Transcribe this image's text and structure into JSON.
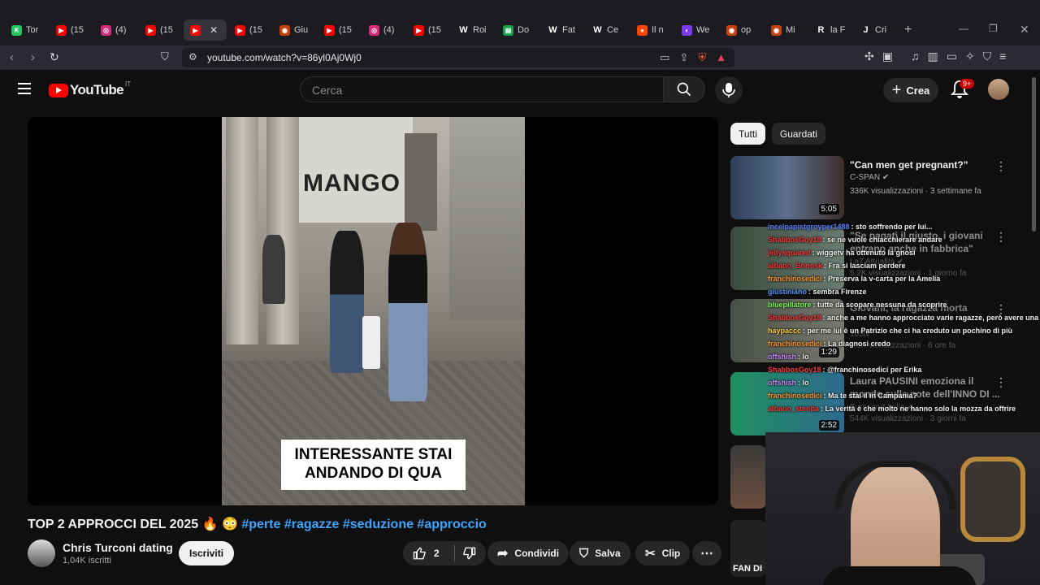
{
  "browser": {
    "tabs": [
      {
        "label": "Tor",
        "icon": "k-icon",
        "color": "#22c55e",
        "letter": "K"
      },
      {
        "label": "(15",
        "icon": "youtube-icon",
        "color": "#ff0000",
        "letter": "▶"
      },
      {
        "label": "(4)",
        "icon": "instagram-icon",
        "color": "#d62976",
        "letter": "◎"
      },
      {
        "label": "(15",
        "icon": "youtube-icon",
        "color": "#ff0000",
        "letter": "▶"
      },
      {
        "label": "",
        "icon": "youtube-icon",
        "color": "#ff0000",
        "letter": "▶",
        "active": true
      },
      {
        "label": "(15",
        "icon": "youtube-icon",
        "color": "#ff0000",
        "letter": "▶"
      },
      {
        "label": "Giu",
        "icon": "globe-icon",
        "color": "#c2410c",
        "letter": "◉"
      },
      {
        "label": "(15",
        "icon": "youtube-icon",
        "color": "#ff0000",
        "letter": "▶"
      },
      {
        "label": "(4)",
        "icon": "instagram-icon",
        "color": "#d62976",
        "letter": "◎"
      },
      {
        "label": "(15",
        "icon": "youtube-icon",
        "color": "#ff0000",
        "letter": "▶"
      },
      {
        "label": "Roi",
        "icon": "wikipedia-icon",
        "color": "#ffffff",
        "letter": "W"
      },
      {
        "label": "Do",
        "icon": "doc-icon",
        "color": "#16a34a",
        "letter": "▤"
      },
      {
        "label": "Fat",
        "icon": "wikipedia-icon",
        "color": "#ffffff",
        "letter": "W"
      },
      {
        "label": "Ce",
        "icon": "wikipedia-icon",
        "color": "#ffffff",
        "letter": "W"
      },
      {
        "label": "Il n",
        "icon": "reddit-icon",
        "color": "#ff4500",
        "letter": "●"
      },
      {
        "label": "We",
        "icon": "circle-icon",
        "color": "#7c3aed",
        "letter": "◐"
      },
      {
        "label": "op",
        "icon": "globe-icon",
        "color": "#c2410c",
        "letter": "◉"
      },
      {
        "label": "Mi",
        "icon": "globe-icon",
        "color": "#c2410c",
        "letter": "◉"
      },
      {
        "label": "la F",
        "icon": "r-icon",
        "color": "#ffffff",
        "letter": "R"
      },
      {
        "label": "Cri",
        "icon": "j-icon",
        "color": "#ffffff",
        "letter": "J"
      }
    ],
    "url": "youtube.com/watch?v=86yl0Aj0Wj0"
  },
  "youtube": {
    "logo_text": "YouTube",
    "country_code": "IT",
    "search_placeholder": "Cerca",
    "create_label": "Crea",
    "notification_count": "9+"
  },
  "video": {
    "caption_line1": "INTERESSANTE STAI",
    "caption_line2": "ANDANDO DI QUA",
    "storefront_text": "MANGO",
    "title": "TOP 2 APPROCCI DEL 2025 🔥 😳",
    "hashtags": "#perte #ragazze #seduzione #approccio",
    "channel_name": "Chris Turconi dating",
    "subscribers": "1,04K iscritti",
    "subscribe_label": "Iscriviti",
    "like_count": "2",
    "share_label": "Condividi",
    "save_label": "Salva",
    "clip_label": "Clip"
  },
  "sidebar": {
    "chips": [
      "Tutti",
      "Guardati"
    ],
    "recommendations": [
      {
        "title": "\"Can men get pregnant?\"",
        "channel": "C-SPAN ✔",
        "meta": "336K visualizzazioni · 3 settimane fa",
        "duration": "5:05"
      },
      {
        "title": "\"Se pagati il giusto, i giovani entrano anche in fabbrica\"",
        "channel": "La7 Attualità ✔",
        "meta": "5,2K visualizzazioni · 1 giorno fa",
        "duration": ""
      },
      {
        "title": "Giovani, la ragazza morta",
        "channel": "105tv",
        "meta": "3,1K visualizzazioni · 6 ore fa",
        "duration": "1:29"
      },
      {
        "title": "Laura PAUSINI emoziona il mondo sulle note dell'INNO DI ...",
        "channel": "Eurosport Italia ✔",
        "meta": "544K visualizzazioni · 3 giorni fa",
        "duration": "2:52"
      }
    ]
  },
  "chat": [
    {
      "user": "incelpapistgroyper1488",
      "color": "#5b7fff",
      "text": ": sto soffrendo per lui..."
    },
    {
      "user": "ShabbosGoy18",
      "color": "#ff3b3b",
      "text": ": se ne vuole chiacchierare andare"
    },
    {
      "user": "jellysquared",
      "color": "#ff3b3b",
      "text": ": wiggetv ha ottenuto la gnosi"
    },
    {
      "user": "albano_Bonosk",
      "color": "#ff3b3b",
      "text": ": Fra si lasciam perdere"
    },
    {
      "user": "franchinosedici",
      "color": "#ff9a2e",
      "text": ": Preserva la v-carta per la Amelia"
    },
    {
      "user": "giustiniano",
      "color": "#4a9aff",
      "text": ": sembra Firenze"
    },
    {
      "user": "bluepillatore",
      "color": "#7cff4a",
      "text": ": tutte da scopare nessuna da scoprire"
    },
    {
      "user": "ShabbosGoy18",
      "color": "#ff3b3b",
      "text": ": anche a me hanno approcciato varie ragazze, però avere una ragazza è crazy"
    },
    {
      "user": "haypaccc",
      "color": "#ffd23a",
      "text": ": per me lui è un Patrizio che ci ha creduto un pochino di più"
    },
    {
      "user": "franchinosedici",
      "color": "#ff9a2e",
      "text": ": La diagnosi credo"
    },
    {
      "user": "offshish",
      "color": "#c98bff",
      "text": ": lo"
    },
    {
      "user": "ShabbosGoy18",
      "color": "#ff3b3b",
      "text": ": @franchinosedici per Erika"
    },
    {
      "user": "offshish",
      "color": "#c98bff",
      "text": ": lo"
    },
    {
      "user": "franchinosedici",
      "color": "#ff9a2e",
      "text": ": Ma te stai il in Campania?"
    },
    {
      "user": "albano_stenba",
      "color": "#ff3b3b",
      "text": ": La verità è che molto ne hanno solo la mozza da offrire"
    }
  ],
  "webcam_overlay_text": "FAN DI"
}
